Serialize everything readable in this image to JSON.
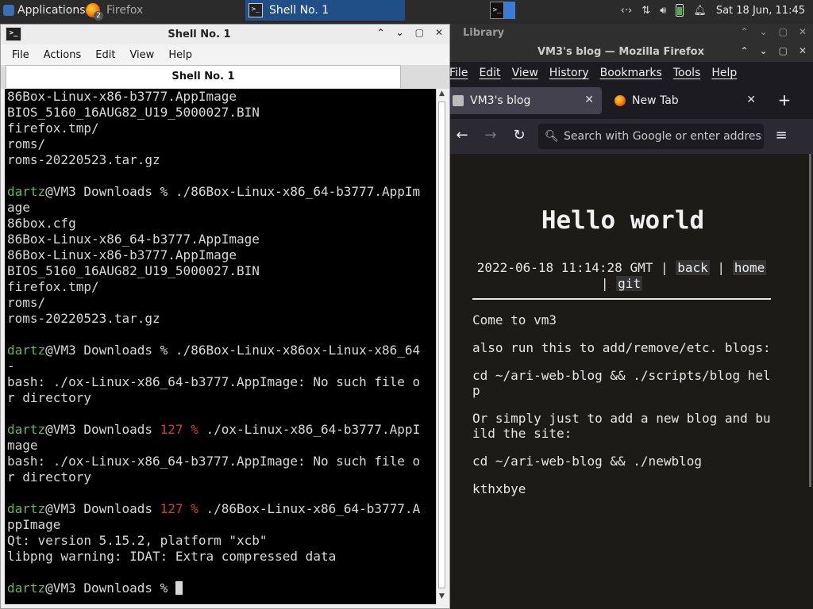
{
  "panel": {
    "applications_label": "Applications",
    "firefox_task_label": "Firefox",
    "firefox_task_count": "2",
    "shell_task_label": "Shell No. 1",
    "clock": "Sat 18 Jun, 11:45"
  },
  "library": {
    "title": "Library"
  },
  "firefox": {
    "window_title": "VM3's blog — Mozilla Firefox",
    "menu": [
      "File",
      "Edit",
      "View",
      "History",
      "Bookmarks",
      "Tools",
      "Help"
    ],
    "tabs": [
      {
        "label": "VM3's blog",
        "active": true
      },
      {
        "label": "New Tab",
        "active": false
      }
    ],
    "urlbar_placeholder": "Search with Google or enter address",
    "page": {
      "title": "Hello world",
      "meta_date": "2022-06-18 11:14:28 GMT",
      "link_back": "back",
      "link_home": "home",
      "link_git": "git",
      "paragraphs": [
        "Come to vm3",
        "also run this to add/remove/etc. blogs:",
        "cd ~/ari-web-blog && ./scripts/blog help",
        "Or simply just to add a new blog and build the site:",
        "cd ~/ari-web-blog && ./newblog",
        "kthxbye"
      ]
    }
  },
  "terminal": {
    "window_title": "Shell No. 1",
    "menu": [
      "File",
      "Actions",
      "Edit",
      "View",
      "Help"
    ],
    "tab_label": "Shell No. 1",
    "lines": [
      [
        {
          "t": "86Box-Linux-x86-b3777.AppImage"
        }
      ],
      [
        {
          "t": "BIOS_5160_16AUG82_U19_5000027.BIN"
        }
      ],
      [
        {
          "t": "firefox.tmp/"
        }
      ],
      [
        {
          "t": "roms/"
        }
      ],
      [
        {
          "t": "roms-20220523.tar.gz"
        }
      ],
      [
        {
          "t": ""
        }
      ],
      [
        {
          "t": "dartz",
          "c": "u"
        },
        {
          "t": "@VM3 Downloads % ./86Box-Linux-x86_64-b3777.AppIm"
        }
      ],
      [
        {
          "t": "age"
        }
      ],
      [
        {
          "t": "86box.cfg"
        }
      ],
      [
        {
          "t": "86Box-Linux-x86_64-b3777.AppImage"
        }
      ],
      [
        {
          "t": "86Box-Linux-x86-b3777.AppImage"
        }
      ],
      [
        {
          "t": "BIOS_5160_16AUG82_U19_5000027.BIN"
        }
      ],
      [
        {
          "t": "firefox.tmp/"
        }
      ],
      [
        {
          "t": "roms/"
        }
      ],
      [
        {
          "t": "roms-20220523.tar.gz"
        }
      ],
      [
        {
          "t": ""
        }
      ],
      [
        {
          "t": "dartz",
          "c": "u"
        },
        {
          "t": "@VM3 Downloads % ./86Box-Linux-x86ox-Linux-x86_64"
        }
      ],
      [
        {
          "t": "-"
        }
      ],
      [
        {
          "t": "bash: ./ox-Linux-x86_64-b3777.AppImage: No such file o"
        }
      ],
      [
        {
          "t": "r directory"
        }
      ],
      [
        {
          "t": ""
        }
      ],
      [
        {
          "t": "dartz",
          "c": "u"
        },
        {
          "t": "@VM3 Downloads "
        },
        {
          "t": "127 %",
          "c": "err"
        },
        {
          "t": " ./ox-Linux-x86_64-b3777.AppI"
        }
      ],
      [
        {
          "t": "mage"
        }
      ],
      [
        {
          "t": "bash: ./ox-Linux-x86_64-b3777.AppImage: No such file o"
        }
      ],
      [
        {
          "t": "r directory"
        }
      ],
      [
        {
          "t": ""
        }
      ],
      [
        {
          "t": "dartz",
          "c": "u"
        },
        {
          "t": "@VM3 Downloads "
        },
        {
          "t": "127 %",
          "c": "err"
        },
        {
          "t": " ./86Box-Linux-x86_64-b3777.A"
        }
      ],
      [
        {
          "t": "ppImage"
        }
      ],
      [
        {
          "t": "Qt: version 5.15.2, platform \"xcb\""
        }
      ],
      [
        {
          "t": "libpng warning: IDAT: Extra compressed data"
        }
      ],
      [
        {
          "t": ""
        }
      ],
      [
        {
          "t": "dartz",
          "c": "u"
        },
        {
          "t": "@VM3 Downloads % "
        },
        {
          "cursor": true
        }
      ]
    ]
  }
}
